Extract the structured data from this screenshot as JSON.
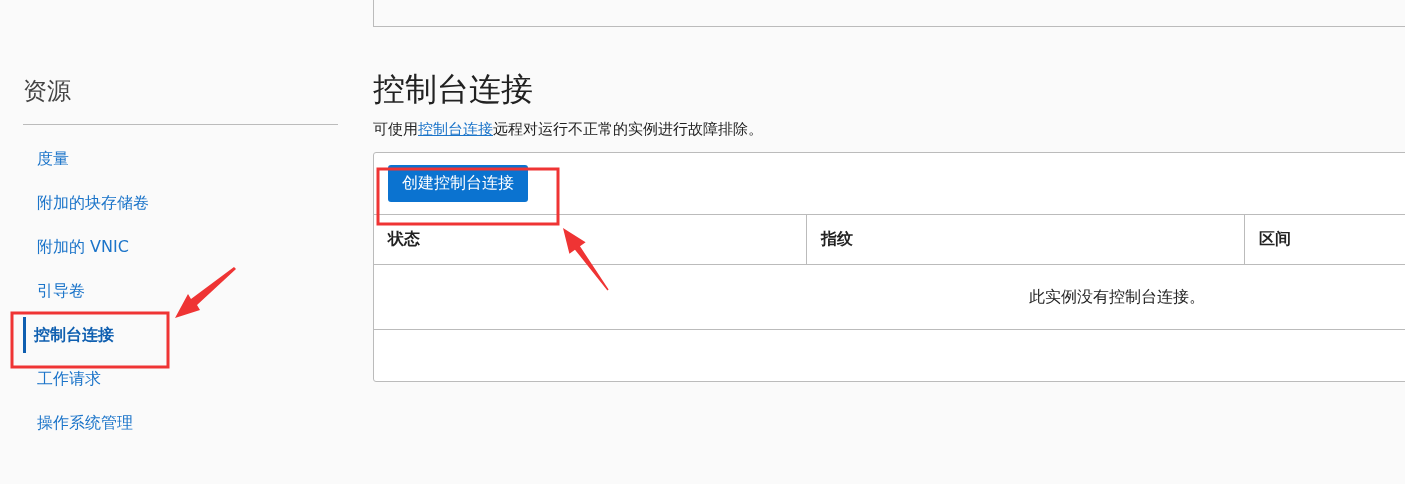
{
  "sidebar": {
    "title": "资源",
    "items": [
      {
        "label": "度量",
        "selected": false
      },
      {
        "label": "附加的块存储卷",
        "selected": false
      },
      {
        "label": "附加的 VNIC",
        "selected": false
      },
      {
        "label": "引导卷",
        "selected": false
      },
      {
        "label": "控制台连接",
        "selected": true
      },
      {
        "label": "工作请求",
        "selected": false
      },
      {
        "label": "操作系统管理",
        "selected": false
      }
    ]
  },
  "section": {
    "title": "控制台连接",
    "description": {
      "before": "可使用",
      "link": "控制台连接",
      "after": "远程对运行不正常的实例进行故障排除。"
    },
    "create_button": "创建控制台连接",
    "table": {
      "columns": [
        "状态",
        "指纹",
        "区间"
      ],
      "empty_message": "此实例没有控制台连接。"
    }
  }
}
